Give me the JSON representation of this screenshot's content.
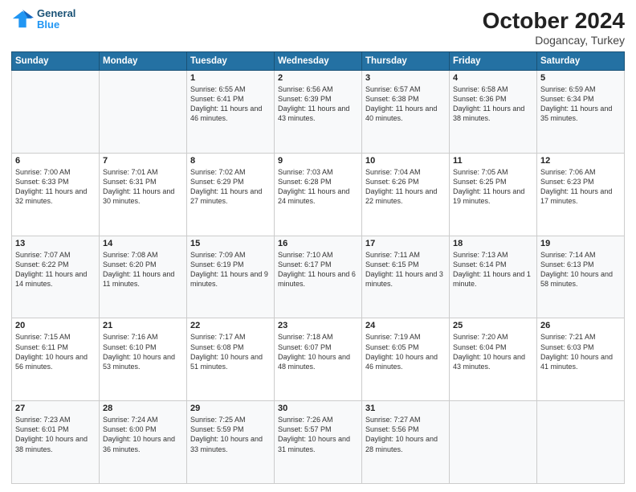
{
  "header": {
    "logo": {
      "line1": "General",
      "line2": "Blue"
    },
    "title": "October 2024",
    "subtitle": "Dogancay, Turkey"
  },
  "weekdays": [
    "Sunday",
    "Monday",
    "Tuesday",
    "Wednesday",
    "Thursday",
    "Friday",
    "Saturday"
  ],
  "weeks": [
    [
      {
        "day": "",
        "info": ""
      },
      {
        "day": "",
        "info": ""
      },
      {
        "day": "1",
        "info": "Sunrise: 6:55 AM\nSunset: 6:41 PM\nDaylight: 11 hours and 46 minutes."
      },
      {
        "day": "2",
        "info": "Sunrise: 6:56 AM\nSunset: 6:39 PM\nDaylight: 11 hours and 43 minutes."
      },
      {
        "day": "3",
        "info": "Sunrise: 6:57 AM\nSunset: 6:38 PM\nDaylight: 11 hours and 40 minutes."
      },
      {
        "day": "4",
        "info": "Sunrise: 6:58 AM\nSunset: 6:36 PM\nDaylight: 11 hours and 38 minutes."
      },
      {
        "day": "5",
        "info": "Sunrise: 6:59 AM\nSunset: 6:34 PM\nDaylight: 11 hours and 35 minutes."
      }
    ],
    [
      {
        "day": "6",
        "info": "Sunrise: 7:00 AM\nSunset: 6:33 PM\nDaylight: 11 hours and 32 minutes."
      },
      {
        "day": "7",
        "info": "Sunrise: 7:01 AM\nSunset: 6:31 PM\nDaylight: 11 hours and 30 minutes."
      },
      {
        "day": "8",
        "info": "Sunrise: 7:02 AM\nSunset: 6:29 PM\nDaylight: 11 hours and 27 minutes."
      },
      {
        "day": "9",
        "info": "Sunrise: 7:03 AM\nSunset: 6:28 PM\nDaylight: 11 hours and 24 minutes."
      },
      {
        "day": "10",
        "info": "Sunrise: 7:04 AM\nSunset: 6:26 PM\nDaylight: 11 hours and 22 minutes."
      },
      {
        "day": "11",
        "info": "Sunrise: 7:05 AM\nSunset: 6:25 PM\nDaylight: 11 hours and 19 minutes."
      },
      {
        "day": "12",
        "info": "Sunrise: 7:06 AM\nSunset: 6:23 PM\nDaylight: 11 hours and 17 minutes."
      }
    ],
    [
      {
        "day": "13",
        "info": "Sunrise: 7:07 AM\nSunset: 6:22 PM\nDaylight: 11 hours and 14 minutes."
      },
      {
        "day": "14",
        "info": "Sunrise: 7:08 AM\nSunset: 6:20 PM\nDaylight: 11 hours and 11 minutes."
      },
      {
        "day": "15",
        "info": "Sunrise: 7:09 AM\nSunset: 6:19 PM\nDaylight: 11 hours and 9 minutes."
      },
      {
        "day": "16",
        "info": "Sunrise: 7:10 AM\nSunset: 6:17 PM\nDaylight: 11 hours and 6 minutes."
      },
      {
        "day": "17",
        "info": "Sunrise: 7:11 AM\nSunset: 6:15 PM\nDaylight: 11 hours and 3 minutes."
      },
      {
        "day": "18",
        "info": "Sunrise: 7:13 AM\nSunset: 6:14 PM\nDaylight: 11 hours and 1 minute."
      },
      {
        "day": "19",
        "info": "Sunrise: 7:14 AM\nSunset: 6:13 PM\nDaylight: 10 hours and 58 minutes."
      }
    ],
    [
      {
        "day": "20",
        "info": "Sunrise: 7:15 AM\nSunset: 6:11 PM\nDaylight: 10 hours and 56 minutes."
      },
      {
        "day": "21",
        "info": "Sunrise: 7:16 AM\nSunset: 6:10 PM\nDaylight: 10 hours and 53 minutes."
      },
      {
        "day": "22",
        "info": "Sunrise: 7:17 AM\nSunset: 6:08 PM\nDaylight: 10 hours and 51 minutes."
      },
      {
        "day": "23",
        "info": "Sunrise: 7:18 AM\nSunset: 6:07 PM\nDaylight: 10 hours and 48 minutes."
      },
      {
        "day": "24",
        "info": "Sunrise: 7:19 AM\nSunset: 6:05 PM\nDaylight: 10 hours and 46 minutes."
      },
      {
        "day": "25",
        "info": "Sunrise: 7:20 AM\nSunset: 6:04 PM\nDaylight: 10 hours and 43 minutes."
      },
      {
        "day": "26",
        "info": "Sunrise: 7:21 AM\nSunset: 6:03 PM\nDaylight: 10 hours and 41 minutes."
      }
    ],
    [
      {
        "day": "27",
        "info": "Sunrise: 7:23 AM\nSunset: 6:01 PM\nDaylight: 10 hours and 38 minutes."
      },
      {
        "day": "28",
        "info": "Sunrise: 7:24 AM\nSunset: 6:00 PM\nDaylight: 10 hours and 36 minutes."
      },
      {
        "day": "29",
        "info": "Sunrise: 7:25 AM\nSunset: 5:59 PM\nDaylight: 10 hours and 33 minutes."
      },
      {
        "day": "30",
        "info": "Sunrise: 7:26 AM\nSunset: 5:57 PM\nDaylight: 10 hours and 31 minutes."
      },
      {
        "day": "31",
        "info": "Sunrise: 7:27 AM\nSunset: 5:56 PM\nDaylight: 10 hours and 28 minutes."
      },
      {
        "day": "",
        "info": ""
      },
      {
        "day": "",
        "info": ""
      }
    ]
  ]
}
